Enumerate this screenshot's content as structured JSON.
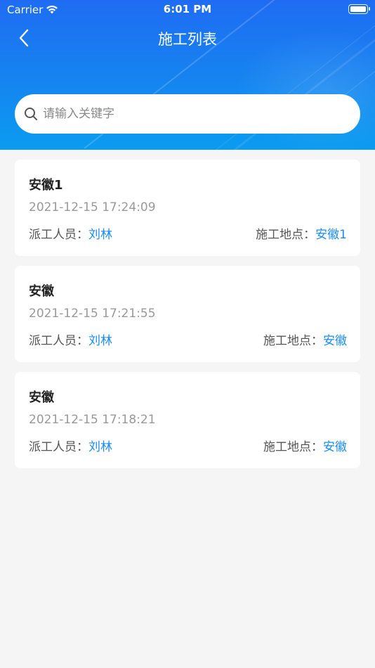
{
  "status_bar": {
    "carrier": "Carrier",
    "time": "6:01 PM"
  },
  "nav": {
    "title": "施工列表",
    "back_icon": "chevron-left-icon"
  },
  "search": {
    "placeholder": "请输入关键字",
    "value": "",
    "icon": "search-icon"
  },
  "colors": {
    "header_gradient_top": "#1f6cf2",
    "header_gradient_bottom": "#0a9cf0",
    "accent": "#1a8cf0",
    "background": "#f5f5f5"
  },
  "records": [
    {
      "title": "安徽1",
      "time": "2021-12-15 17:24:09",
      "dispatch_label": "派工人员：",
      "dispatch_value": "刘林",
      "location_label": "施工地点：",
      "location_value": "安徽1"
    },
    {
      "title": "安徽",
      "time": "2021-12-15 17:21:55",
      "dispatch_label": "派工人员：",
      "dispatch_value": "刘林",
      "location_label": "施工地点：",
      "location_value": "安徽"
    },
    {
      "title": "安徽",
      "time": "2021-12-15 17:18:21",
      "dispatch_label": "派工人员：",
      "dispatch_value": "刘林",
      "location_label": "施工地点：",
      "location_value": "安徽"
    }
  ]
}
